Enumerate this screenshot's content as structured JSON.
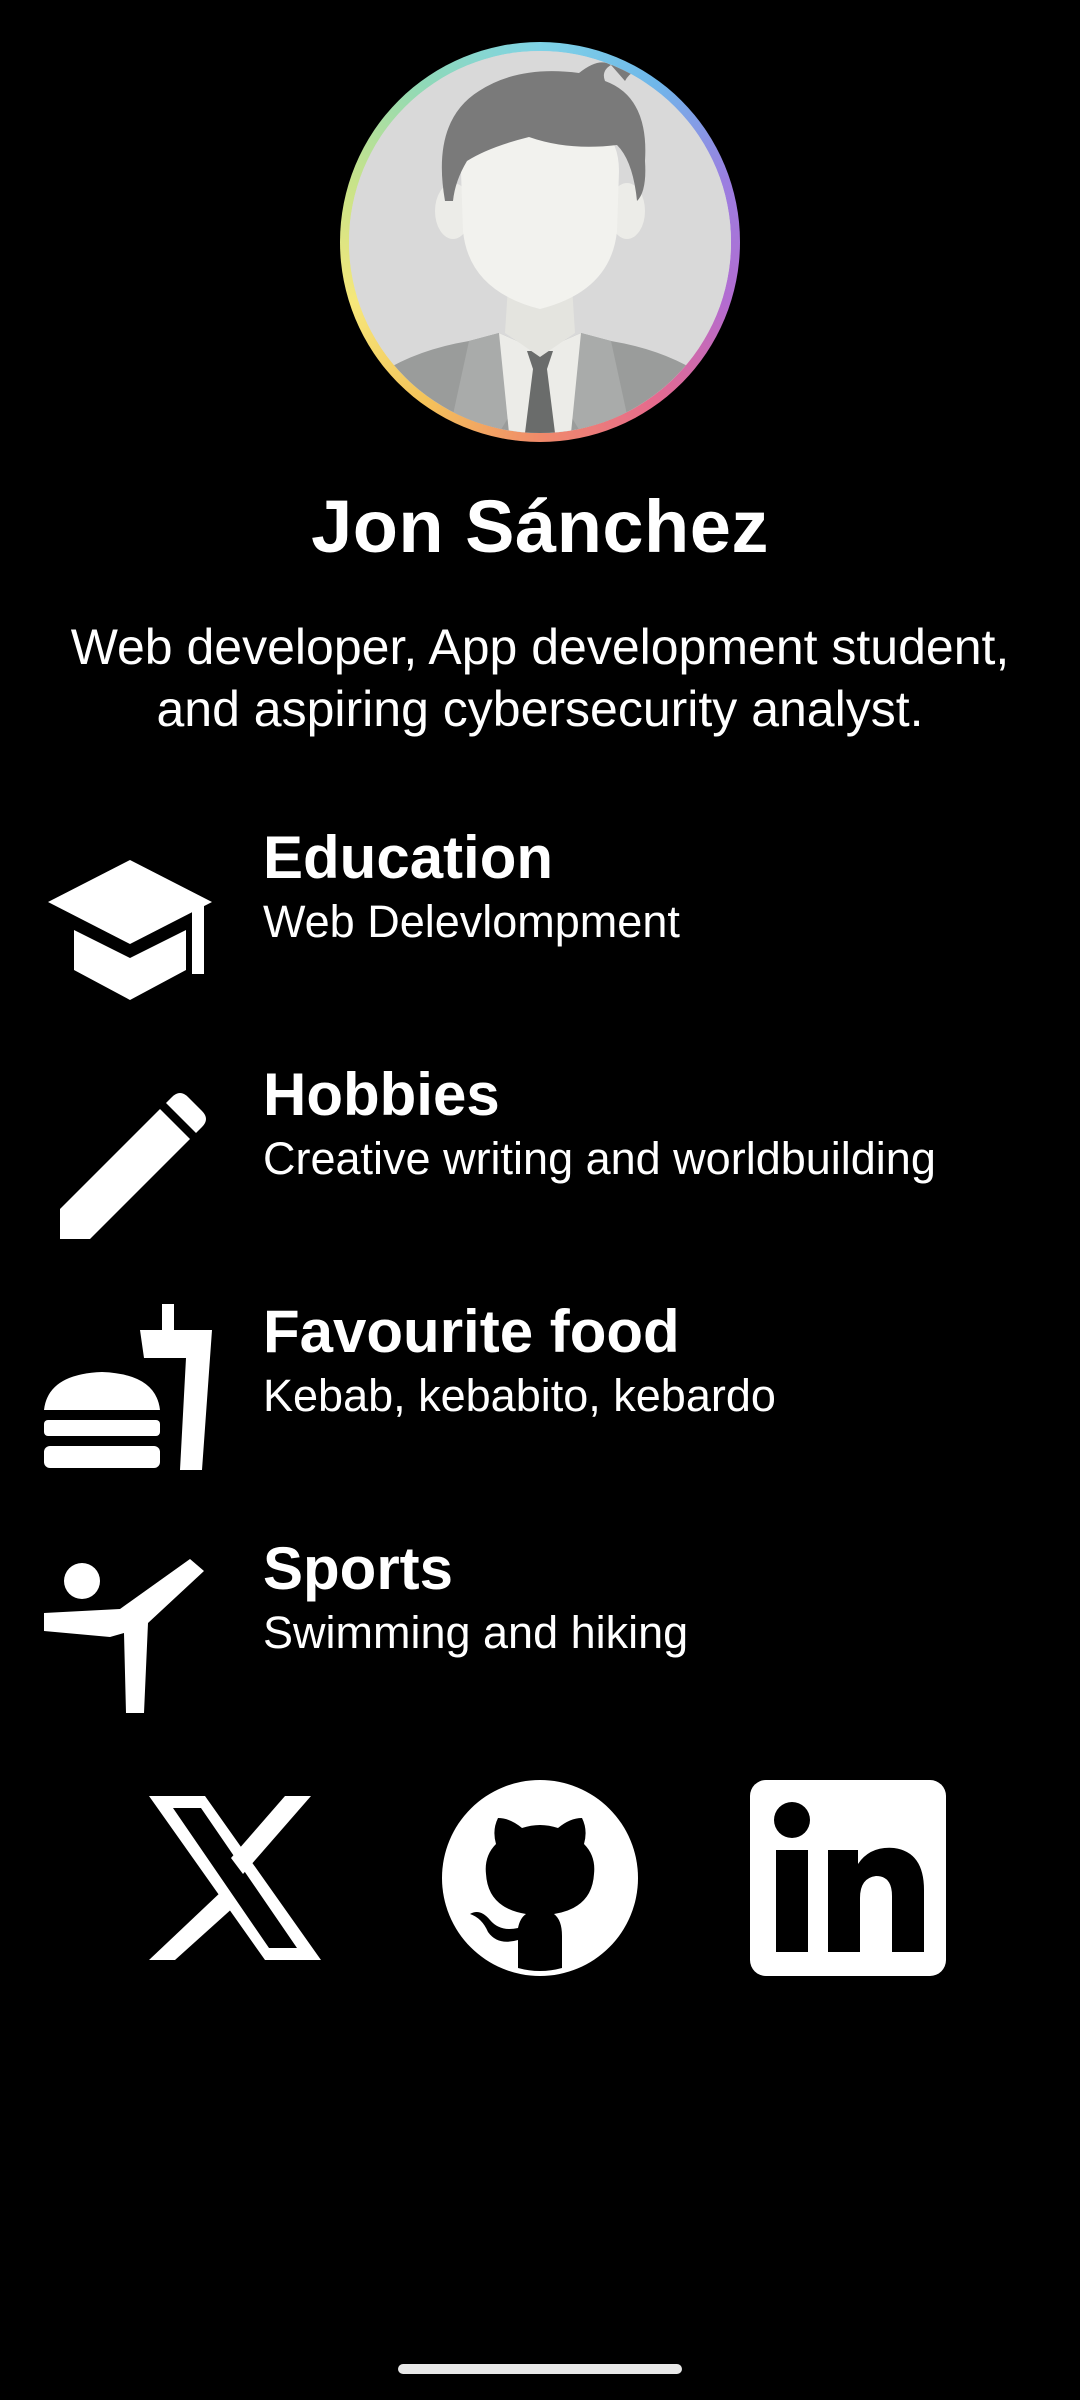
{
  "profile": {
    "name": "Jon Sánchez",
    "bio_line1": "Web developer, App development student,",
    "bio_line2": "and aspiring cybersecurity analyst."
  },
  "info": [
    {
      "title": "Education",
      "subtitle": "Web Delevlompment",
      "icon": "graduation-cap-icon"
    },
    {
      "title": "Hobbies",
      "subtitle": "Creative writing and worldbuilding",
      "icon": "pencil-icon"
    },
    {
      "title": "Favourite food",
      "subtitle": "Kebab, kebabito, kebardo",
      "icon": "fastfood-icon"
    },
    {
      "title": "Sports",
      "subtitle": "Swimming and hiking",
      "icon": "sports-martial-arts-icon"
    }
  ],
  "social": [
    {
      "name": "X",
      "icon": "x-logo-icon"
    },
    {
      "name": "GitHub",
      "icon": "github-logo-icon"
    },
    {
      "name": "LinkedIn",
      "icon": "linkedin-logo-icon"
    }
  ],
  "colors": {
    "background": "#000000",
    "text": "#ffffff",
    "avatar_bg": "#d8d8d8"
  }
}
